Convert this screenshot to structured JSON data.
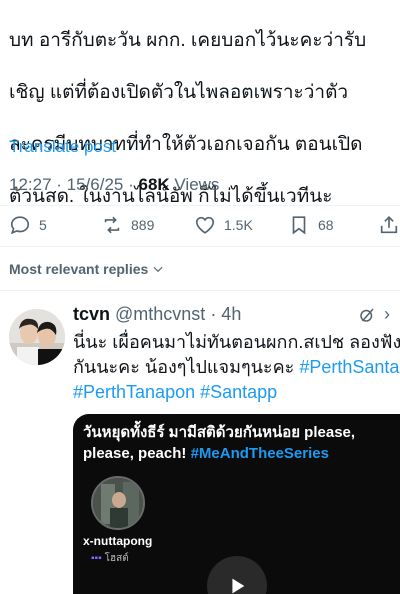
{
  "post": {
    "text": "บท อารีกับตะวัน ผกก. เคยบอกไว้นะคะว่ารับเชิญ แต่ที่ต้องเปิดตัวในไพลอตเพราะว่าตัวละครมีบทบาทที่ทำให้ตัวเอกเจอกัน ตอนเปิดตัวนสด. ในงานไลน์อัพ ก็ไม่ได้ขึ้นเวทีนะ",
    "lines": [
      "บท อารีกับตะวัน ผกก. เคยบอกไว้นะคะว่ารับ",
      "เชิญ แต่ที่ต้องเปิดตัวในไพลอตเพราะว่าตัว",
      "ละครมีบทบาทที่ทำให้ตัวเอกเจอกัน ตอนเปิด",
      "ตัวนสด. ในงานไลน์อัพ ก็ไม่ได้ขึ้นเวทีนะ"
    ],
    "translate_label": "Translate post",
    "time": "12:27 · 15/6/25 · ",
    "views_count": "68K",
    "views_label": " Views"
  },
  "actions": {
    "replies": "5",
    "reposts": "889",
    "likes": "1.5K",
    "bookmarks": "68"
  },
  "sort_label": "Most relevant replies",
  "reply": {
    "name": "tcvn",
    "handle": " @mthcvnst",
    "time": " · 4h",
    "more": "›",
    "line1": "นี่นะ เผื่อคนมาไม่ทันตอนผกก.สเปช ลองฟัง",
    "line2_text": "กันนะคะ น้องๆไปแจมๆนะคะ ",
    "line2_tag": "#PerthSanta",
    "line3_tag1": "#PerthTanapon",
    "line3_tag2": "#Santapp",
    "media": {
      "caption_text": "วันหยุดทั้งธีร์ มามีสติด้วยกันหน่อย please, please, peach! ",
      "caption_tag": "#MeAndTheeSeries",
      "host_name": "x-nuttapong",
      "host_role": "โฮสต์"
    }
  },
  "colors": {
    "text": "#0f1419",
    "secondary": "#536471",
    "link": "#1d9bf0",
    "divider": "#eff3f4"
  }
}
